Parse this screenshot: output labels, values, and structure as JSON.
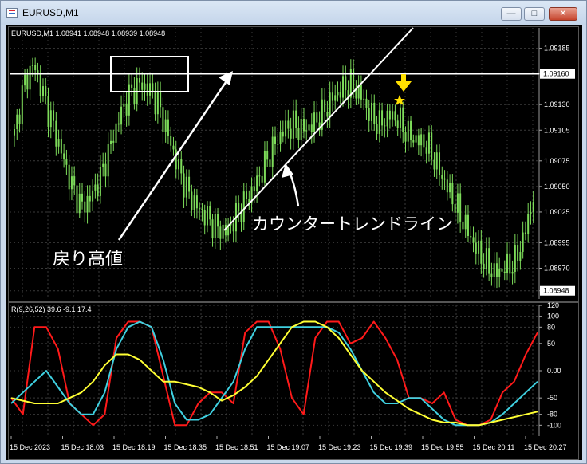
{
  "window": {
    "title": "EURUSD,M1",
    "min_label": "—",
    "max_label": "□",
    "close_label": "✕"
  },
  "chart": {
    "info": "EURUSD,M1  1.08941 1.08948 1.08939 1.08948",
    "current_price_label": "1.08948",
    "resistance_label": "1.09160",
    "annotation_pullback": "戻り高値",
    "annotation_trendline": "カウンタートレンドライン",
    "oscillator_info": "R(9,26,52) 39.6 -9.1 17.4",
    "colors": {
      "bull": "#7ddc5a",
      "line": "#ffffff",
      "arrow": "#ffe000",
      "osc_red": "#ff1a1a",
      "osc_cyan": "#3fd0e0",
      "osc_yellow": "#ffff33"
    }
  },
  "chart_data": [
    {
      "type": "candlestick",
      "title": "EURUSD,M1",
      "y_ticks": [
        "1.09185",
        "1.09160",
        "1.09130",
        "1.09105",
        "1.09075",
        "1.09050",
        "1.09025",
        "1.08995",
        "1.08970",
        "1.08948"
      ],
      "ylim": [
        1.0894,
        1.09205
      ],
      "resistance": 1.0916,
      "close_series": [
        1.091,
        1.0915,
        1.0917,
        1.0914,
        1.0911,
        1.0908,
        1.0905,
        1.0903,
        1.0904,
        1.0906,
        1.0909,
        1.0912,
        1.0914,
        1.0915,
        1.09145,
        1.0913,
        1.091,
        1.0907,
        1.09045,
        1.0903,
        1.0902,
        1.0901,
        1.09005,
        1.0902,
        1.09035,
        1.0905,
        1.0907,
        1.0909,
        1.09105,
        1.0911,
        1.09105,
        1.0911,
        1.0912,
        1.09135,
        1.09145,
        1.0915,
        1.0914,
        1.0912,
        1.0911,
        1.0912,
        1.09115,
        1.091,
        1.09095,
        1.0909,
        1.0907,
        1.0905,
        1.0903,
        1.0901,
        1.0899,
        1.08975,
        1.08965,
        1.0897,
        1.08975,
        1.09,
        1.0904
      ]
    },
    {
      "type": "line",
      "title": "R(9,26,52) 39.6 -9.1 17.4",
      "y_ticks": [
        "120",
        "100",
        "80",
        "50",
        "0.00",
        "-50",
        "-80",
        "-100"
      ],
      "x_ticks": [
        "15 Dec 2023",
        "15 Dec 18:03",
        "15 Dec 18:19",
        "15 Dec 18:35",
        "15 Dec 18:51",
        "15 Dec 19:07",
        "15 Dec 19:23",
        "15 Dec 19:39",
        "15 Dec 19:55",
        "15 Dec 20:11",
        "15 Dec 20:27"
      ],
      "ylim": [
        -120,
        120
      ],
      "series": [
        {
          "values": [
            -50,
            -80,
            80,
            80,
            40,
            -60,
            -80,
            -100,
            -80,
            60,
            90,
            90,
            80,
            -10,
            -100,
            -100,
            -60,
            -40,
            -40,
            -60,
            70,
            90,
            90,
            40,
            -50,
            -80,
            60,
            90,
            90,
            50,
            60,
            90,
            60,
            20,
            -50,
            -50,
            -60,
            -40,
            -90,
            -100,
            -100,
            -90,
            -40,
            -20,
            30,
            70
          ]
        },
        {
          "values": [
            -60,
            -40,
            -20,
            0,
            -30,
            -60,
            -80,
            -80,
            -40,
            40,
            80,
            90,
            80,
            20,
            -60,
            -90,
            -90,
            -80,
            -50,
            -20,
            40,
            80,
            80,
            80,
            80,
            80,
            80,
            80,
            70,
            40,
            0,
            -40,
            -60,
            -60,
            -50,
            -50,
            -70,
            -90,
            -100,
            -100,
            -100,
            -95,
            -80,
            -60,
            -40,
            -20
          ]
        },
        {
          "values": [
            -50,
            -55,
            -60,
            -60,
            -60,
            -50,
            -40,
            -20,
            10,
            30,
            30,
            20,
            0,
            -20,
            -20,
            -25,
            -30,
            -40,
            -55,
            -45,
            -30,
            -10,
            20,
            50,
            80,
            90,
            90,
            80,
            60,
            30,
            0,
            -20,
            -40,
            -55,
            -70,
            -80,
            -90,
            -95,
            -95,
            -100,
            -100,
            -95,
            -90,
            -85,
            -80,
            -75
          ]
        }
      ]
    }
  ]
}
